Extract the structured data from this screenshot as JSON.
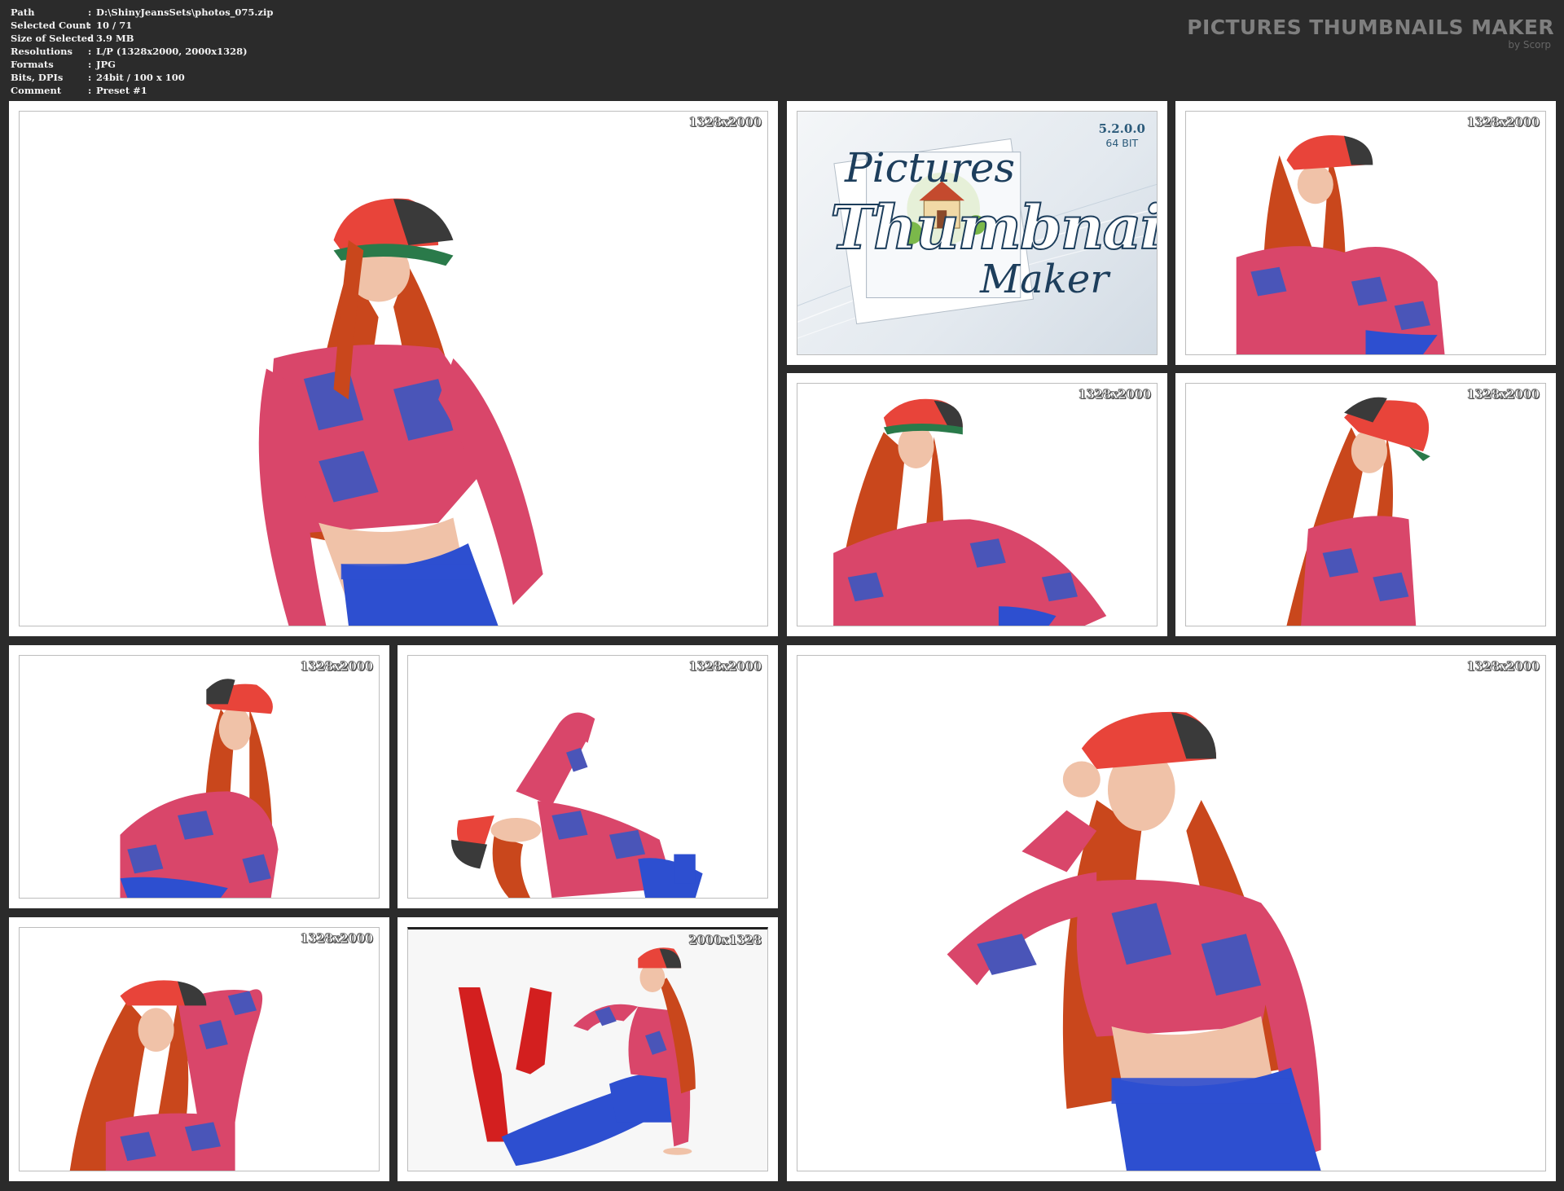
{
  "info": {
    "rows": [
      {
        "key": "Path",
        "value": "D:\\ShinyJeansSets\\photos_075.zip"
      },
      {
        "key": "Selected Count",
        "value": "10 / 71"
      },
      {
        "key": "Size of Selected",
        "value": "3.9 MB"
      },
      {
        "key": "Resolutions",
        "value": "L/P (1328x2000, 2000x1328)"
      },
      {
        "key": "Formats",
        "value": "JPG"
      },
      {
        "key": "Bits, DPIs",
        "value": "24bit / 100 x 100"
      },
      {
        "key": "Comment",
        "value": "Preset #1"
      }
    ]
  },
  "brand": {
    "title": "PICTURES THUMBNAILS MAKER",
    "subtitle": "by Scorp"
  },
  "logo": {
    "word1": "Pictures",
    "word2": "Thumbnails",
    "word3": "Maker",
    "version": "5.2.0.0",
    "arch": "64 BIT"
  },
  "thumbnails": [
    {
      "id": "thumb-1",
      "resolution": "1328x2000"
    },
    {
      "id": "thumb-2",
      "resolution": "1328x2000"
    },
    {
      "id": "thumb-3",
      "resolution": "1328x2000"
    },
    {
      "id": "thumb-4",
      "resolution": "1328x2000"
    },
    {
      "id": "thumb-5",
      "resolution": "1328x2000"
    },
    {
      "id": "thumb-6",
      "resolution": "1328x2000"
    },
    {
      "id": "thumb-7",
      "resolution": "1328x2000"
    },
    {
      "id": "thumb-8",
      "resolution": "2000x1328"
    },
    {
      "id": "thumb-9",
      "resolution": "1328x2000"
    }
  ],
  "colors": {
    "background": "#2b2b2b",
    "hair": "#c9471c",
    "cap_red": "#e8443a",
    "cap_dark": "#3a3a3a",
    "shirt_red": "#d9466a",
    "shirt_blue": "#4a55b8",
    "pants_blue": "#2d4fd0",
    "skin": "#f0c2a8"
  }
}
